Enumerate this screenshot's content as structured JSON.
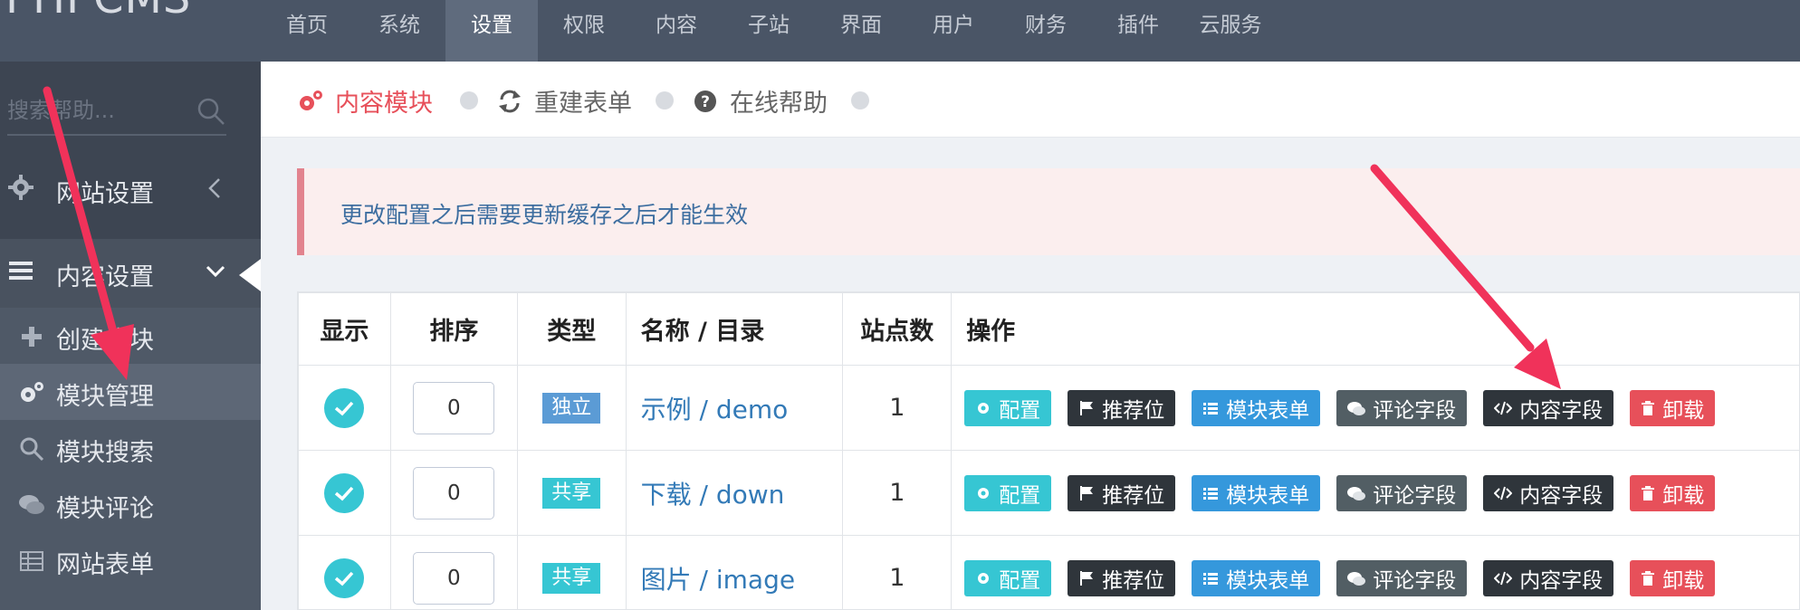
{
  "app": {
    "logo": "PHPCMS"
  },
  "topnav": {
    "items": [
      "首页",
      "系统",
      "设置",
      "权限",
      "内容",
      "子站",
      "界面",
      "用户",
      "财务",
      "插件",
      "云服务"
    ],
    "active_index": 2
  },
  "sidebar": {
    "search_placeholder": "搜索帮助...",
    "groups": [
      {
        "label": "网站设置",
        "icon": "gear-icon"
      },
      {
        "label": "内容设置",
        "icon": "menu-lines-icon"
      }
    ],
    "sub_items": [
      {
        "label": "创建模块",
        "icon": "plus-icon"
      },
      {
        "label": "模块管理",
        "icon": "gears-icon"
      },
      {
        "label": "模块搜索",
        "icon": "search-icon"
      },
      {
        "label": "模块评论",
        "icon": "comments-icon"
      },
      {
        "label": "网站表单",
        "icon": "table-icon"
      }
    ]
  },
  "pagebar": {
    "tabs": [
      {
        "label": "内容模块",
        "icon": "gears-icon",
        "active": true
      },
      {
        "label": "重建表单",
        "icon": "refresh-icon",
        "active": false
      },
      {
        "label": "在线帮助",
        "icon": "question-icon",
        "active": false
      }
    ]
  },
  "alert": {
    "text": "更改配置之后需要更新缓存之后才能生效"
  },
  "table": {
    "headers": [
      "显示",
      "排序",
      "类型",
      "名称 / 目录",
      "站点数",
      "操作"
    ],
    "rows": [
      {
        "order": "0",
        "type": "独立",
        "type_color": "#5b9bd5",
        "name": "示例 / demo",
        "sites": "1"
      },
      {
        "order": "0",
        "type": "共享",
        "type_color": "#36c6d3",
        "name": "下载 / down",
        "sites": "1"
      },
      {
        "order": "0",
        "type": "共享",
        "type_color": "#36c6d3",
        "name": "图片 / image",
        "sites": "1"
      }
    ],
    "actions": {
      "config": "配置",
      "recommend": "推荐位",
      "module_form": "模块表单",
      "comment_field": "评论字段",
      "content_field": "内容字段",
      "uninstall": "卸载"
    }
  },
  "colors": {
    "topbar": "#4a5566",
    "sidebar": "#3d4552",
    "accent_red": "#e7505a",
    "arrow": "#f0325a"
  }
}
